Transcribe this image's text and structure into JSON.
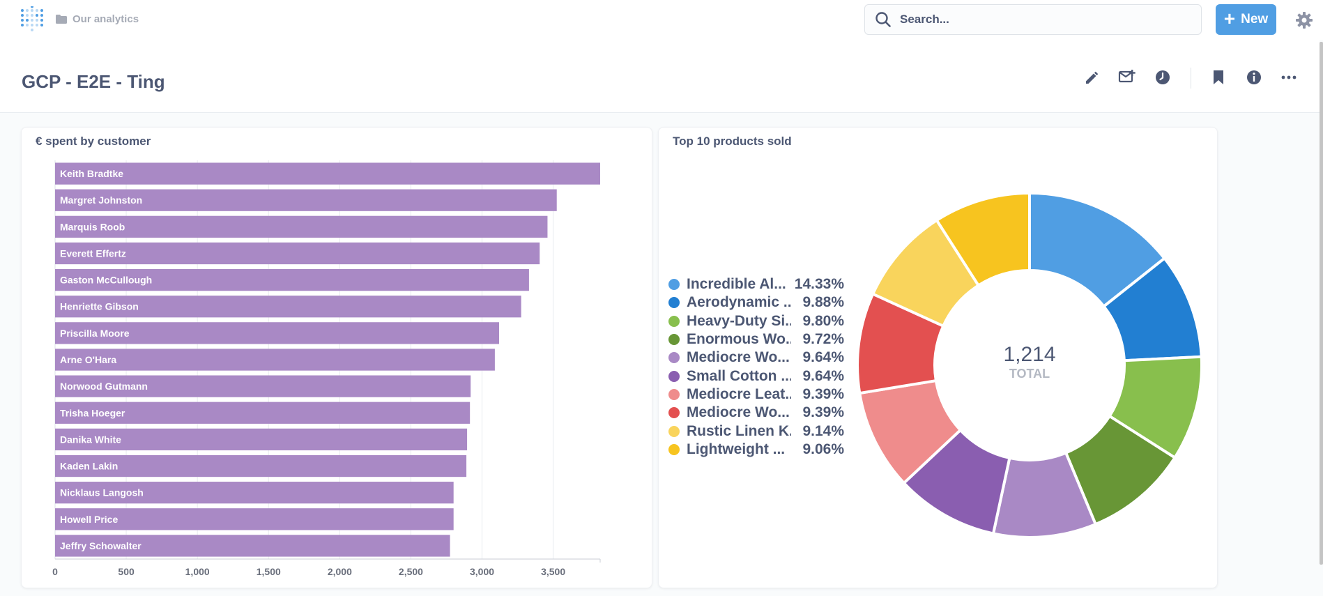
{
  "nav": {
    "breadcrumb": "Our analytics",
    "search_placeholder": "Search...",
    "new_label": "New"
  },
  "dashboard": {
    "title": "GCP - E2E - Ting",
    "actions": [
      "edit",
      "subscriptions",
      "history",
      "bookmark",
      "info",
      "more"
    ]
  },
  "icons": {
    "logo": "metabase-logo-icon",
    "folder": "folder-icon",
    "search": "search-icon",
    "settings": "gear-icon",
    "edit": "pencil-icon",
    "subscriptions": "mail-add-icon",
    "history": "clock-icon",
    "bookmark": "bookmark-icon",
    "info": "info-icon",
    "more": "ellipsis-icon"
  },
  "colors": {
    "accent": "#509ee3",
    "bar": "#a989c5"
  },
  "cards": {
    "bar_title": "€ spent by customer",
    "pie_title": "Top 10 products sold"
  },
  "chart_data": [
    {
      "type": "bar",
      "orientation": "horizontal",
      "title": "€ spent by customer",
      "categories": [
        "Keith Bradtke",
        "Margret Johnston",
        "Marquis Roob",
        "Everett Effertz",
        "Gaston McCullough",
        "Henriette Gibson",
        "Priscilla Moore",
        "Arne O'Hara",
        "Norwood Gutmann",
        "Trisha Hoeger",
        "Danika White",
        "Kaden Lakin",
        "Nicklaus Langosh",
        "Howell Price",
        "Jeffry Schowalter"
      ],
      "values": [
        3830,
        3525,
        3460,
        3405,
        3330,
        3275,
        3120,
        3090,
        2920,
        2915,
        2895,
        2890,
        2800,
        2800,
        2775
      ],
      "xlim": [
        0,
        3830
      ],
      "xticks": [
        "0",
        "500",
        "1,000",
        "1,500",
        "2,000",
        "2,500",
        "3,000",
        "3,500"
      ],
      "tick_values": [
        0,
        500,
        1000,
        1500,
        2000,
        2500,
        3000,
        3500
      ],
      "grid": true
    },
    {
      "type": "pie",
      "donut": true,
      "title": "Top 10 products sold",
      "total_value": "1,214",
      "total_label": "TOTAL",
      "slices": [
        {
          "label": "Incredible Al...",
          "percent_label": "14.33%",
          "value": 14.33,
          "color": "#509ee3"
        },
        {
          "label": "Aerodynamic ...",
          "percent_label": "9.88%",
          "value": 9.88,
          "color": "#227fd2"
        },
        {
          "label": "Heavy-Duty Si...",
          "percent_label": "9.80%",
          "value": 9.8,
          "color": "#88bf4d"
        },
        {
          "label": "Enormous Wo...",
          "percent_label": "9.72%",
          "value": 9.72,
          "color": "#689636"
        },
        {
          "label": "Mediocre Wo...",
          "percent_label": "9.64%",
          "value": 9.64,
          "color": "#a989c5"
        },
        {
          "label": "Small Cotton ...",
          "percent_label": "9.64%",
          "value": 9.64,
          "color": "#8a5eb0"
        },
        {
          "label": "Mediocre Leat...",
          "percent_label": "9.39%",
          "value": 9.39,
          "color": "#ef8c8c"
        },
        {
          "label": "Mediocre Wo...",
          "percent_label": "9.39%",
          "value": 9.39,
          "color": "#e35050"
        },
        {
          "label": "Rustic Linen K...",
          "percent_label": "9.14%",
          "value": 9.14,
          "color": "#f9d45c"
        },
        {
          "label": "Lightweight ...",
          "percent_label": "9.06%",
          "value": 9.06,
          "color": "#f7c41f"
        }
      ],
      "legend_position": "left"
    }
  ]
}
